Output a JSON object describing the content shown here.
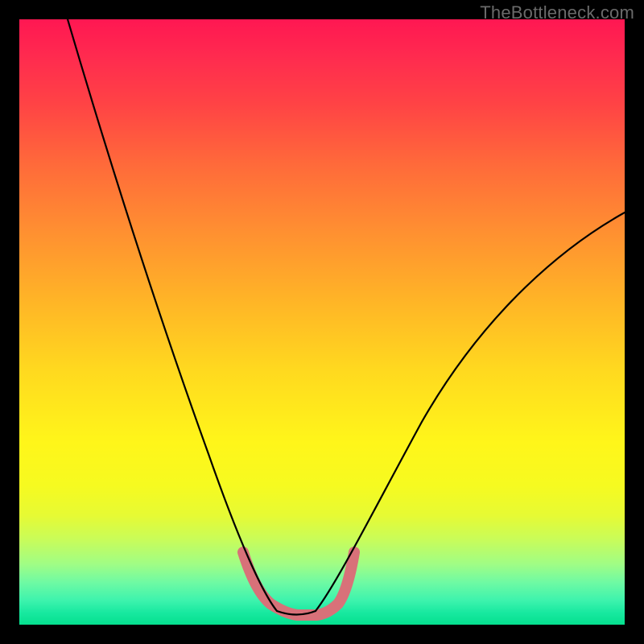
{
  "watermark": "TheBottleneck.com",
  "chart_data": {
    "type": "line",
    "title": "",
    "xlabel": "",
    "ylabel": "",
    "xlim": [
      0,
      100
    ],
    "ylim": [
      0,
      100
    ],
    "grid": false,
    "legend": false,
    "background_gradient": {
      "top_color": "#ff1752",
      "bottom_color": "#05e08e",
      "description": "vertical red→orange→yellow→green gradient"
    },
    "series": [
      {
        "name": "left-curve",
        "x": [
          8,
          12,
          16,
          20,
          24,
          28,
          32,
          35,
          38,
          40,
          42.5
        ],
        "y": [
          100,
          84,
          70,
          56,
          44,
          34,
          24,
          16,
          9,
          4,
          2
        ]
      },
      {
        "name": "right-curve",
        "x": [
          49,
          51,
          54,
          58,
          63,
          70,
          78,
          86,
          94,
          100
        ],
        "y": [
          2,
          4,
          8,
          14,
          22,
          32,
          43,
          53,
          62,
          68
        ]
      },
      {
        "name": "bottom-flat",
        "x": [
          42.5,
          45,
          47,
          49
        ],
        "y": [
          2,
          1.6,
          1.6,
          2
        ]
      }
    ],
    "highlight": {
      "name": "pink-threshold-band",
      "color": "#d87179",
      "x": [
        37,
        39,
        41,
        43,
        45,
        47,
        49,
        51,
        53
      ],
      "y": [
        12,
        6,
        3,
        2,
        1.8,
        2,
        3,
        6,
        12
      ]
    }
  }
}
